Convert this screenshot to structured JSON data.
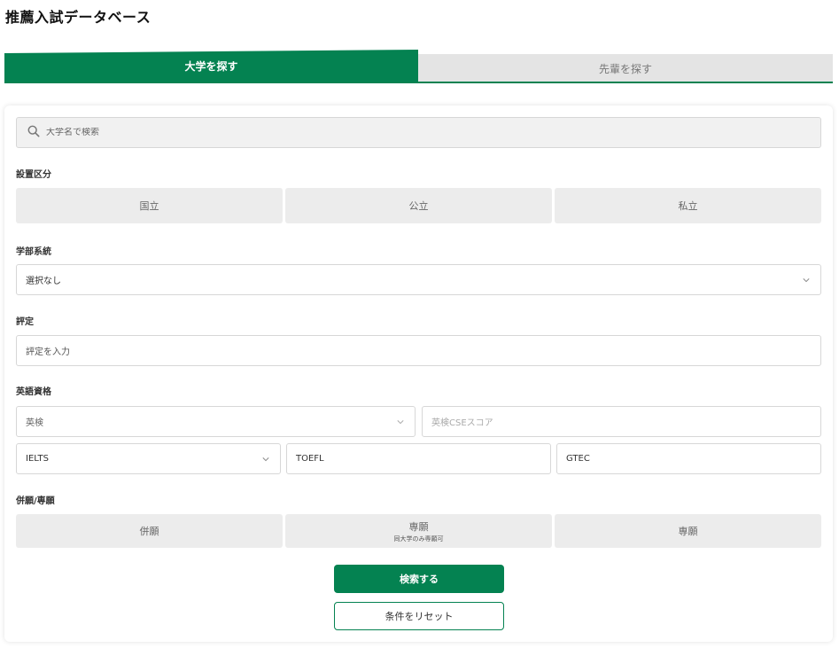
{
  "page": {
    "title": "推薦入試データベース"
  },
  "tabs": [
    {
      "label": "大学を探す",
      "active": true
    },
    {
      "label": "先輩を探す",
      "active": false
    }
  ],
  "search": {
    "placeholder": "大学名で検索",
    "icon": "search-icon"
  },
  "establishment": {
    "label": "設置区分",
    "options": [
      "国立",
      "公立",
      "私立"
    ]
  },
  "faculty": {
    "label": "学部系統",
    "value": "選択なし"
  },
  "grade": {
    "label": "評定",
    "placeholder": "評定を入力"
  },
  "english": {
    "label": "英語資格",
    "eiken_select": "英検",
    "eiken_score_placeholder": "英検CSEスコア",
    "ielts_select": "IELTS",
    "toefl_value": "TOEFL",
    "gtec_value": "GTEC"
  },
  "application_type": {
    "label": "併願/専願",
    "options": [
      {
        "label": "併願",
        "sub": ""
      },
      {
        "label": "専願",
        "sub": "同大学のみ専願可"
      },
      {
        "label": "専願",
        "sub": ""
      }
    ]
  },
  "actions": {
    "search_label": "検索する",
    "reset_label": "条件をリセット"
  },
  "colors": {
    "accent": "#048251",
    "segment_bg": "#ececec",
    "inactive_tab_bg": "#e4e4e4"
  }
}
